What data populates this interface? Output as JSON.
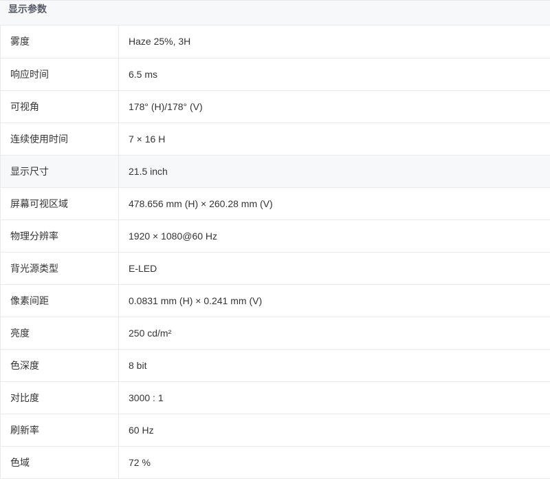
{
  "section": {
    "title": "显示参数"
  },
  "rows": [
    {
      "label": "雾度",
      "value": "Haze 25%, 3H"
    },
    {
      "label": "响应时间",
      "value": "6.5 ms"
    },
    {
      "label": "可视角",
      "value": "178° (H)/178° (V)"
    },
    {
      "label": "连续使用时间",
      "value": "7 × 16 H"
    },
    {
      "label": "显示尺寸",
      "value": "21.5 inch"
    },
    {
      "label": "屏幕可视区域",
      "value": "478.656 mm (H) × 260.28 mm (V)"
    },
    {
      "label": "物理分辨率",
      "value": "1920 × 1080@60 Hz"
    },
    {
      "label": "背光源类型",
      "value": "E-LED"
    },
    {
      "label": "像素间距",
      "value": "0.0831 mm (H) × 0.241 mm (V)"
    },
    {
      "label": "亮度",
      "value": "250 cd/m²"
    },
    {
      "label": "色深度",
      "value": "8 bit"
    },
    {
      "label": "对比度",
      "value": "3000 : 1"
    },
    {
      "label": "刷新率",
      "value": "60 Hz"
    },
    {
      "label": "色域",
      "value": "72 %"
    }
  ]
}
